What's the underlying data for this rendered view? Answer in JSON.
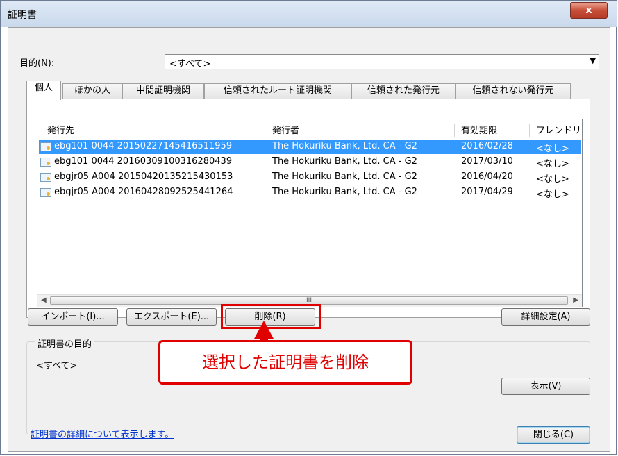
{
  "window": {
    "title": "証明書",
    "close_glyph": "x"
  },
  "purpose": {
    "label": "目的(N):",
    "value": "<すべて>"
  },
  "tabs": [
    {
      "label": "個人",
      "active": true
    },
    {
      "label": "ほかの人",
      "active": false
    },
    {
      "label": "中間証明機関",
      "active": false
    },
    {
      "label": "信頼されたルート証明機関",
      "active": false
    },
    {
      "label": "信頼された発行元",
      "active": false
    },
    {
      "label": "信頼されない発行元",
      "active": false
    }
  ],
  "columns": [
    "発行先",
    "発行者",
    "有効期限",
    "フレンドリ名"
  ],
  "rows": [
    {
      "issued_to": "ebg101 0044 20150227145416511959",
      "issued_by": "The Hokuriku Bank, Ltd. CA - G2",
      "expires": "2016/02/28",
      "friendly": "<なし>",
      "selected": true
    },
    {
      "issued_to": "ebg101 0044 20160309100316280439",
      "issued_by": "The Hokuriku Bank, Ltd. CA - G2",
      "expires": "2017/03/10",
      "friendly": "<なし>",
      "selected": false
    },
    {
      "issued_to": "ebgjr05 A004 20150420135215430153",
      "issued_by": "The Hokuriku Bank, Ltd. CA - G2",
      "expires": "2016/04/20",
      "friendly": "<なし>",
      "selected": false
    },
    {
      "issued_to": "ebgjr05 A004 20160428092525441264",
      "issued_by": "The Hokuriku Bank, Ltd. CA - G2",
      "expires": "2017/04/29",
      "friendly": "<なし>",
      "selected": false
    }
  ],
  "scrollbar": {
    "thumb_grip": "III"
  },
  "buttons": {
    "import": "インポート(I)...",
    "export": "エクスポート(E)...",
    "delete": "削除(R)",
    "advanced": "詳細設定(A)",
    "view": "表示(V)",
    "close": "閉じる(C)"
  },
  "purpose_group": {
    "title": "証明書の目的",
    "value": "<すべて>"
  },
  "details_link": "証明書の詳細について表示します。",
  "annotation": {
    "callout": "選択した証明書を削除",
    "color": "#e00000"
  },
  "colors": {
    "selection": "#3399ff",
    "link": "#0033cc"
  }
}
